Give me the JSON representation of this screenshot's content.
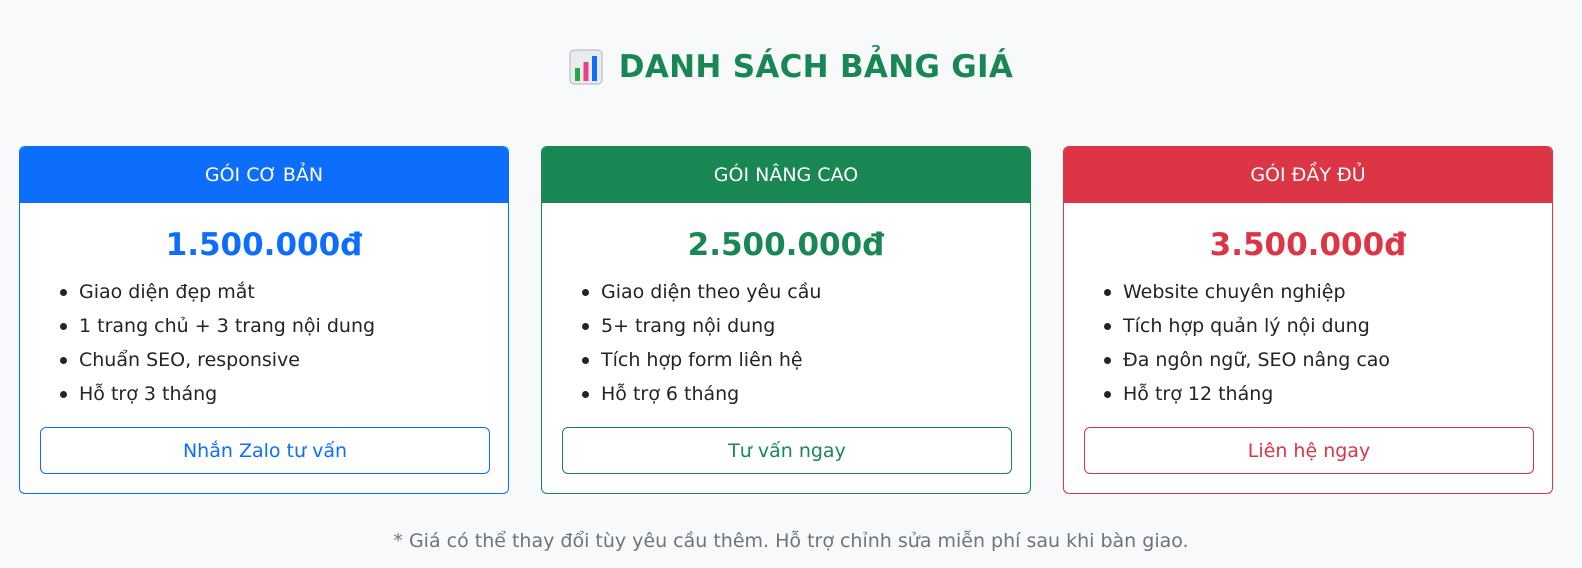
{
  "header": {
    "icon": "bar-chart-icon",
    "title": "DANH SÁCH BẢNG GIÁ"
  },
  "plans": [
    {
      "name": "GÓI CƠ BẢN",
      "price": "1.500.000đ",
      "features": [
        "Giao diện đẹp mắt",
        "1 trang chủ + 3 trang nội dung",
        "Chuẩn SEO, responsive",
        "Hỗ trợ 3 tháng"
      ],
      "cta": "Nhắn Zalo tư vấn",
      "color": "#0d6efd"
    },
    {
      "name": "GÓI NÂNG CAO",
      "price": "2.500.000đ",
      "features": [
        "Giao diện theo yêu cầu",
        "5+ trang nội dung",
        "Tích hợp form liên hệ",
        "Hỗ trợ 6 tháng"
      ],
      "cta": "Tư vấn ngay",
      "color": "#198754"
    },
    {
      "name": "GÓI ĐẦY ĐỦ",
      "price": "3.500.000đ",
      "features": [
        "Website chuyên nghiệp",
        "Tích hợp quản lý nội dung",
        "Đa ngôn ngữ, SEO nâng cao",
        "Hỗ trợ 12 tháng"
      ],
      "cta": "Liên hệ ngay",
      "color": "#dc3545"
    }
  ],
  "footnote": "* Giá có thể thay đổi tùy yêu cầu thêm. Hỗ trợ chỉnh sửa miễn phí sau khi bàn giao.",
  "colors": {
    "title": "#198754",
    "background": "#f8f9fa",
    "muted": "#6c757d"
  }
}
